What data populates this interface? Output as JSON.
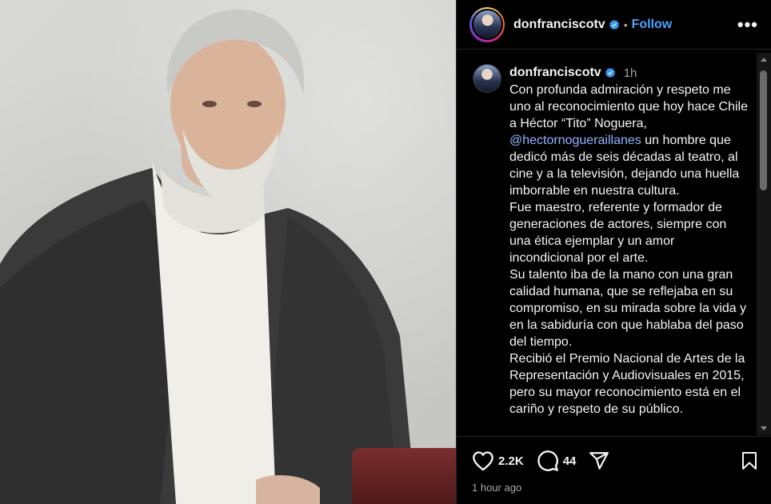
{
  "post": {
    "username": "donfranciscotv",
    "follow_label": "Follow",
    "more_label": "•••",
    "separator": "•",
    "time_short": "1h",
    "time_long": "1 hour ago",
    "caption_before_mention": "Con profunda admiración y respeto me uno al reconocimiento que hoy hace Chile a Héctor “Tito” Noguera, ",
    "mention": "@hectornogueraillanes",
    "caption_after_mention": " un hombre que dedicó más de seis décadas al teatro, al cine y a la televisión, dejando una huella imborrable en nuestra cultura.\nFue maestro, referente y formador de generaciones de actores, siempre con una ética ejemplar y un amor incondicional por el arte.\nSu talento iba de la mano con una gran calidad humana, que se reflejaba en su compromiso, en su mirada sobre la vida y en la sabiduría con que hablaba del paso del tiempo.\nRecibió el Premio Nacional de Artes de la Representación y Audiovisuales en 2015, pero su mayor reconocimiento está en el cariño y respeto de su público.",
    "likes": "2.2K",
    "comments": "44"
  },
  "colors": {
    "background": "#000000",
    "text": "#f5f5f5",
    "muted": "#a8a8a8",
    "link": "#4aa3ff",
    "verified": "#3897f0"
  },
  "icons": [
    "verified-badge-icon",
    "heart-icon",
    "comment-icon",
    "share-icon",
    "bookmark-icon",
    "more-icon"
  ]
}
